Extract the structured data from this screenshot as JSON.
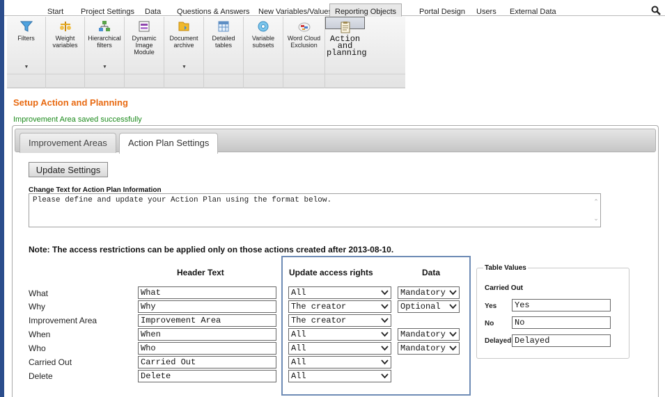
{
  "top_tabs": [
    "Start",
    "Project Settings",
    "Data",
    "Questions & Answers",
    "New Variables/Values",
    "Reporting Objects",
    "Portal Design",
    "Users",
    "External Data"
  ],
  "active_top_tab": "Reporting Objects",
  "ribbon": [
    {
      "label": "Filters",
      "icon": "funnel-icon",
      "dropdown": true
    },
    {
      "label": "Weight\nvariables",
      "icon": "weight-icon",
      "dropdown": false
    },
    {
      "label": "Hierarchical\nfilters",
      "icon": "hierarchy-icon",
      "dropdown": true
    },
    {
      "label": "Dynamic\nImage\nModule",
      "icon": "image-module-icon",
      "dropdown": false
    },
    {
      "label": "Document\narchive",
      "icon": "folder-icon",
      "dropdown": true
    },
    {
      "label": "Detailed\ntables",
      "icon": "table-icon",
      "dropdown": false
    },
    {
      "label": "Variable\nsubsets",
      "icon": "disc-icon",
      "dropdown": false
    },
    {
      "label": "Word Cloud\nExclusion",
      "icon": "word-cloud-icon",
      "dropdown": false
    },
    {
      "label": "Action and\nplanning",
      "icon": "clipboard-icon",
      "dropdown": false
    }
  ],
  "page_title": "Setup Action and Planning",
  "success_message": "Improvement Area saved successfully",
  "panel_tabs": [
    "Improvement Areas",
    "Action Plan Settings"
  ],
  "active_panel_tab": "Action Plan Settings",
  "update_button": "Update Settings",
  "info_label": "Change Text for Action Plan Information",
  "info_text": "Please define and update your Action Plan using the format below.",
  "note": "Note: The access restrictions can be applied only on those actions created after 2013-08-10.",
  "columns": {
    "header_text": "Header Text",
    "access": "Update access rights",
    "data": "Data"
  },
  "rows": [
    {
      "label": "What",
      "header": "What",
      "access": "All",
      "data": "Mandatory"
    },
    {
      "label": "Why",
      "header": "Why",
      "access": "The creator",
      "data": "Optional"
    },
    {
      "label": "Improvement Area",
      "header": "Improvement Area",
      "access": "The creator",
      "data": null
    },
    {
      "label": "When",
      "header": "When",
      "access": "All",
      "data": "Mandatory"
    },
    {
      "label": "Who",
      "header": "Who",
      "access": "All",
      "data": "Mandatory"
    },
    {
      "label": "Carried Out",
      "header": "Carried Out",
      "access": "All",
      "data": null
    },
    {
      "label": "Delete",
      "header": "Delete",
      "access": "All",
      "data": null
    }
  ],
  "table_values": {
    "title": "Table Values",
    "subtitle": "Carried Out",
    "items": [
      {
        "label": "Yes",
        "value": "Yes"
      },
      {
        "label": "No",
        "value": "No"
      },
      {
        "label": "Delayed",
        "value": "Delayed"
      }
    ]
  },
  "colors": {
    "accent_orange": "#e86a12",
    "success_green": "#1b8a1b",
    "highlight_border": "#6e8bb5",
    "left_bar": "#2b4d8c"
  }
}
